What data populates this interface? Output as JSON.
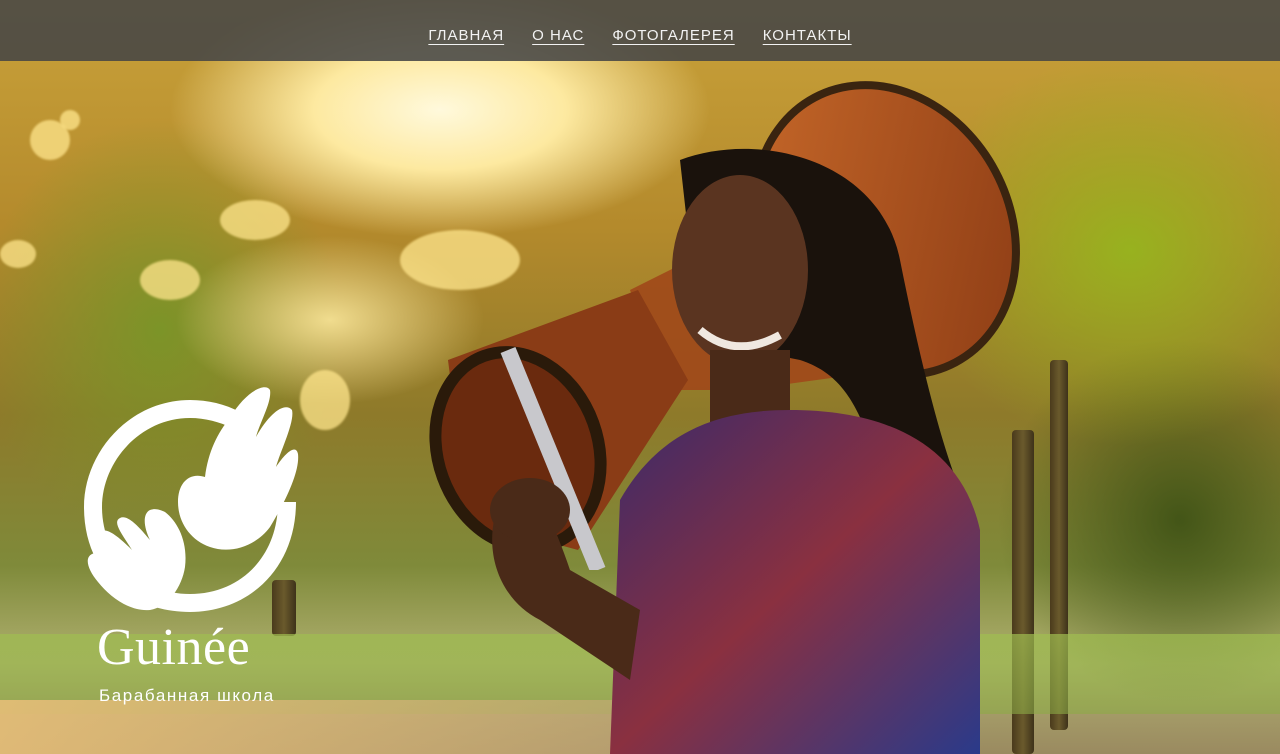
{
  "nav": {
    "items": [
      {
        "label": "ГЛАВНАЯ"
      },
      {
        "label": "О НАС"
      },
      {
        "label": "ФОТОГАЛЕРЕЯ"
      },
      {
        "label": "КОНТАКТЫ"
      }
    ]
  },
  "brand": {
    "name": "Guinée",
    "tagline": "Барабанная школа"
  },
  "hero": {
    "image_subject": "drummer-with-djembe-photo"
  },
  "colors": {
    "nav_bg": "#464646",
    "nav_text": "#f2f2f2",
    "logo": "#ffffff"
  }
}
